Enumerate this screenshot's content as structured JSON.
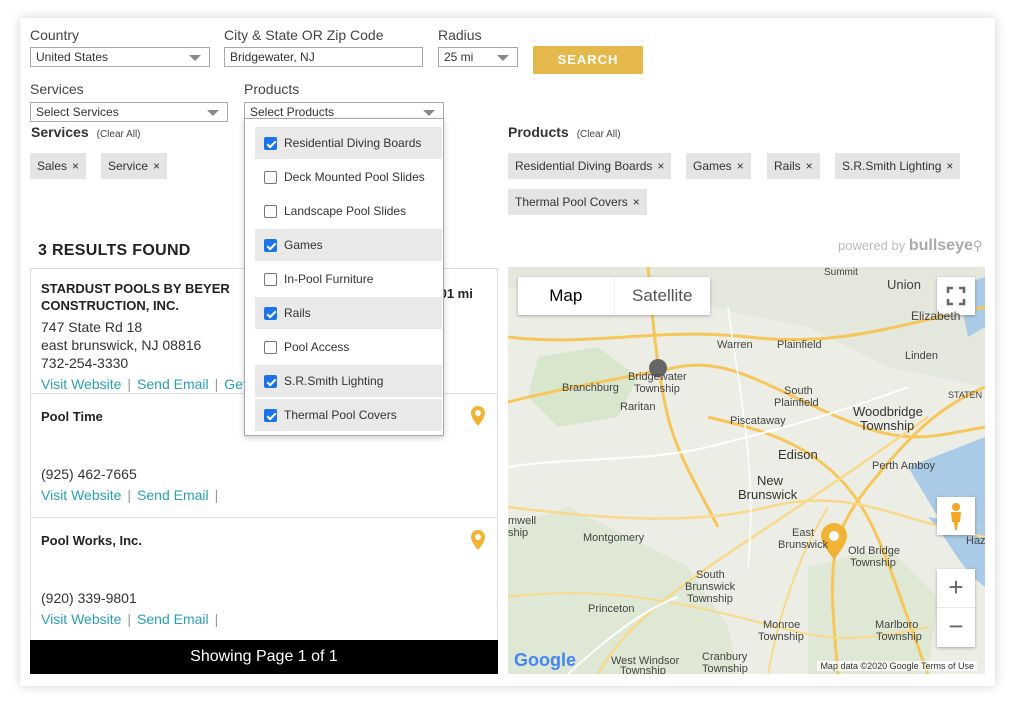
{
  "form": {
    "country_label": "Country",
    "country_value": "United States",
    "city_label": "City & State OR Zip Code",
    "city_value": "Bridgewater, NJ",
    "radius_label": "Radius",
    "radius_value": "25 mi",
    "search_label": "SEARCH",
    "services_label": "Services",
    "services_placeholder": "Select Services",
    "products_label": "Products",
    "products_placeholder": "Select Products"
  },
  "services_filter": {
    "heading": "Services",
    "clear": "(Clear All)",
    "chips": [
      {
        "label": "Sales",
        "x": "×"
      },
      {
        "label": "Service",
        "x": "×"
      }
    ]
  },
  "products_filter": {
    "heading": "Products",
    "clear": "(Clear All)",
    "chips": [
      {
        "label": "Residential Diving Boards",
        "x": "×"
      },
      {
        "label": "Games",
        "x": "×"
      },
      {
        "label": "Rails",
        "x": "×"
      },
      {
        "label": "S.R.Smith Lighting",
        "x": "×"
      },
      {
        "label": "Thermal Pool Covers",
        "x": "×"
      }
    ]
  },
  "products_dropdown": {
    "options": [
      {
        "label": "Residential Diving Boards",
        "checked": true
      },
      {
        "label": "Deck Mounted Pool Slides",
        "checked": false
      },
      {
        "label": "Landscape Pool Slides",
        "checked": false
      },
      {
        "label": "Games",
        "checked": true
      },
      {
        "label": "In-Pool Furniture",
        "checked": false
      },
      {
        "label": "Rails",
        "checked": true
      },
      {
        "label": "Pool Access",
        "checked": false
      },
      {
        "label": "S.R.Smith Lighting",
        "checked": true
      },
      {
        "label": "Thermal Pool Covers",
        "checked": true
      }
    ]
  },
  "results": {
    "title": "3 RESULTS FOUND",
    "powered_prefix": "powered by",
    "powered_brand": "bullseye",
    "items": [
      {
        "name_line1": "STARDUST POOLS BY BEYER",
        "name_line2": "CONSTRUCTION, INC.",
        "distance": ".01 mi",
        "address1": "747 State Rd 18",
        "address2": "east brunswick, NJ 08816",
        "phone": "732-254-3330",
        "link_website": "Visit Website",
        "link_email": "Send Email",
        "link_directions": "Get"
      },
      {
        "name": "Pool Time",
        "phone": "(925) 462-7665",
        "link_website": "Visit Website",
        "link_email": "Send Email"
      },
      {
        "name": "Pool Works, Inc.",
        "phone": "(920) 339-9801",
        "link_website": "Visit Website",
        "link_email": "Send Email"
      }
    ],
    "paging": "Showing Page 1 of 1"
  },
  "map": {
    "type_map": "Map",
    "type_satellite": "Satellite",
    "zoom_in": "+",
    "zoom_out": "−",
    "google": "Google",
    "attribution": "Map data ©2020 Google    Terms of Use",
    "towns": {
      "union": "Union",
      "elizabeth": "Elizabeth",
      "warren": "Warren",
      "plainfield": "Plainfield",
      "linden": "Linden",
      "branchburg": "Branchburg",
      "bridgewater1": "Bridgewater",
      "bridgewater2": "Township",
      "raritan": "Raritan",
      "south_plainfield1": "South",
      "south_plainfield2": "Plainfield",
      "woodbridge1": "Woodbridge",
      "woodbridge2": "Township",
      "piscataway": "Piscataway",
      "edison": "Edison",
      "perth_amboy": "Perth Amboy",
      "new_brunswick1": "New",
      "new_brunswick2": "Brunswick",
      "east_brunswick1": "East",
      "east_brunswick2": "Brunswick",
      "old_bridge1": "Old Bridge",
      "old_bridge2": "Township",
      "montgomery": "Montgomery",
      "hillsborough": "mwell",
      "hillsborough2": "ship",
      "south_brunswick1": "South",
      "south_brunswick2": "Brunswick",
      "south_brunswick3": "Township",
      "princeton": "Princeton",
      "monroe1": "Monroe",
      "monroe2": "Township",
      "marlboro1": "Marlboro",
      "marlboro2": "Township",
      "west_windsor1": "West Windsor",
      "west_windsor2": "Township",
      "cranbury1": "Cranbury",
      "cranbury2": "Township",
      "hazlet": "Hazl",
      "staten": "STATEN",
      "summit": "Summit"
    },
    "shields": [
      "202",
      "78",
      "78",
      "22",
      "22",
      "287",
      "202",
      "27",
      "130",
      "35",
      "9",
      "1",
      "79",
      "440",
      "95",
      "27",
      "9"
    ]
  }
}
